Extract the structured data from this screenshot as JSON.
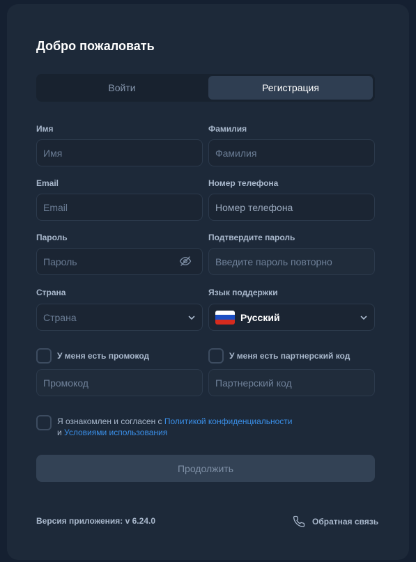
{
  "title": "Добро пожаловать",
  "tabs": {
    "login": "Войти",
    "register": "Регистрация"
  },
  "form": {
    "first_name": {
      "label": "Имя",
      "placeholder": "Имя"
    },
    "last_name": {
      "label": "Фамилия",
      "placeholder": "Фамилия"
    },
    "email": {
      "label": "Email",
      "placeholder": "Email"
    },
    "phone": {
      "label": "Номер телефона",
      "placeholder": "Номер телефона"
    },
    "password": {
      "label": "Пароль",
      "placeholder": "Пароль"
    },
    "confirm_password": {
      "label": "Подтвердите пароль",
      "placeholder": "Введите пароль повторно"
    },
    "country": {
      "label": "Страна",
      "placeholder": "Страна"
    },
    "support_language": {
      "label": "Язык поддержки",
      "value": "Русский"
    },
    "promo": {
      "label": "У меня есть промокод",
      "placeholder": "Промокод"
    },
    "partner": {
      "label": "У меня есть партнерский код",
      "placeholder": "Партнерский код"
    },
    "agree": {
      "text_before": "Я ознакомлен и согласен с ",
      "privacy_link": "Политикой конфиденциальности",
      "text_and": "и ",
      "terms_link": "Условиями использования"
    },
    "continue_label": "Продолжить"
  },
  "footer": {
    "version": "Версия приложения: v 6.24.0",
    "feedback": "Обратная связь"
  },
  "icons": {
    "password_toggle": "eye-off-icon",
    "dropdown": "chevron-down-icon",
    "flag": "russia-flag-icon",
    "feedback": "phone-icon"
  },
  "colors": {
    "background": "#152031",
    "card": "#1d2939",
    "accent_link": "#3a8fe8",
    "active_tab": "#2f3e52"
  }
}
